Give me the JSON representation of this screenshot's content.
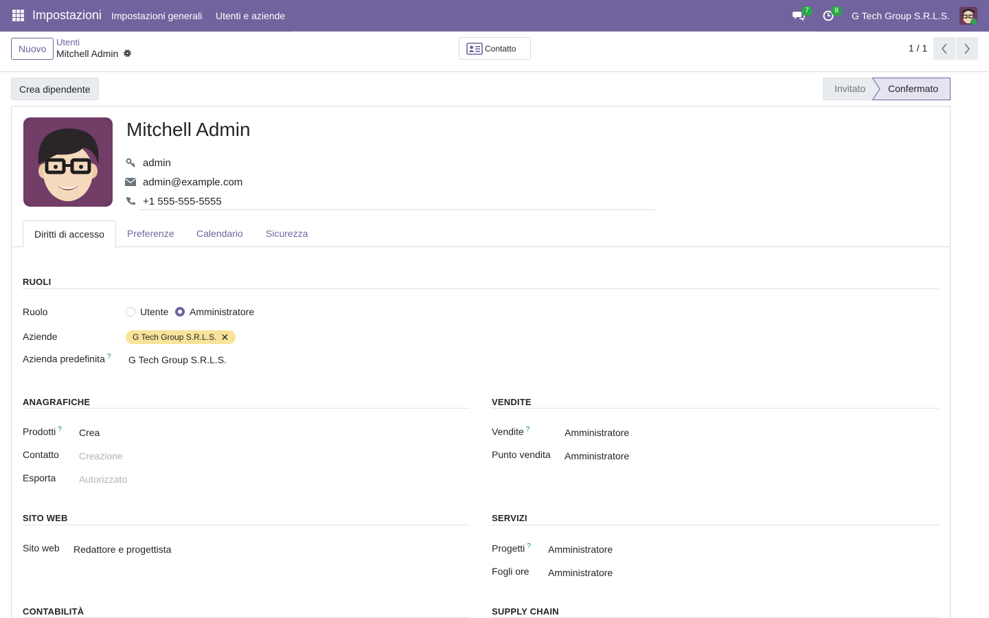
{
  "navbar": {
    "app_name": "Impostazioni",
    "menu": [
      "Impostazioni generali",
      "Utenti e aziende"
    ],
    "messages_count": "7",
    "activities_count": "8",
    "company": "G Tech Group S.R.L.S."
  },
  "control_panel": {
    "new_label": "Nuovo",
    "breadcrumb_parent": "Utenti",
    "breadcrumb_current": "Mitchell Admin",
    "smart_button": "Contatto",
    "pager": "1 / 1"
  },
  "statusbar": {
    "action_button": "Crea dipendente",
    "stages": [
      "Invitato",
      "Confermato"
    ],
    "active_stage": "Confermato"
  },
  "record": {
    "name": "Mitchell Admin",
    "login": "admin",
    "email": "admin@example.com",
    "phone": "+1 555-555-5555"
  },
  "tabs": [
    "Diritti di accesso",
    "Preferenze",
    "Calendario",
    "Sicurezza"
  ],
  "roles": {
    "title": "RUOLI",
    "role_label": "Ruolo",
    "role_options": [
      "Utente",
      "Amministratore"
    ],
    "selected_role": "Amministratore",
    "companies_label": "Aziende",
    "companies_tag": "G Tech Group S.R.L.S.",
    "default_company_label": "Azienda predefinita",
    "default_company_value": "G Tech Group S.R.L.S.",
    "help_mark": "?"
  },
  "anagrafiche": {
    "title": "ANAGRAFICHE",
    "rows": [
      {
        "label": "Prodotti",
        "value": "Crea"
      },
      {
        "label": "Contatto",
        "value": "Creazione"
      },
      {
        "label": "Esporta",
        "value": "Autorizzato"
      }
    ]
  },
  "vendite": {
    "title": "VENDITE",
    "rows": [
      {
        "label": "Vendite",
        "value": "Amministratore"
      },
      {
        "label": "Punto vendita",
        "value": "Amministratore"
      }
    ]
  },
  "sito_web": {
    "title": "SITO WEB",
    "rows": [
      {
        "label": "Sito web",
        "value": "Redattore e progettista"
      }
    ]
  },
  "servizi": {
    "title": "SERVIZI",
    "rows": [
      {
        "label": "Progetti",
        "value": "Amministratore"
      },
      {
        "label": "Fogli ore",
        "value": "Amministratore"
      }
    ]
  },
  "contabilita": {
    "title": "CONTABILITÀ"
  },
  "supply_chain": {
    "title": "SUPPLY CHAIN"
  },
  "colors": {
    "brand": "#71639e",
    "badge": "#28a745",
    "tag": "#f9e39a",
    "link": "#017e84"
  }
}
